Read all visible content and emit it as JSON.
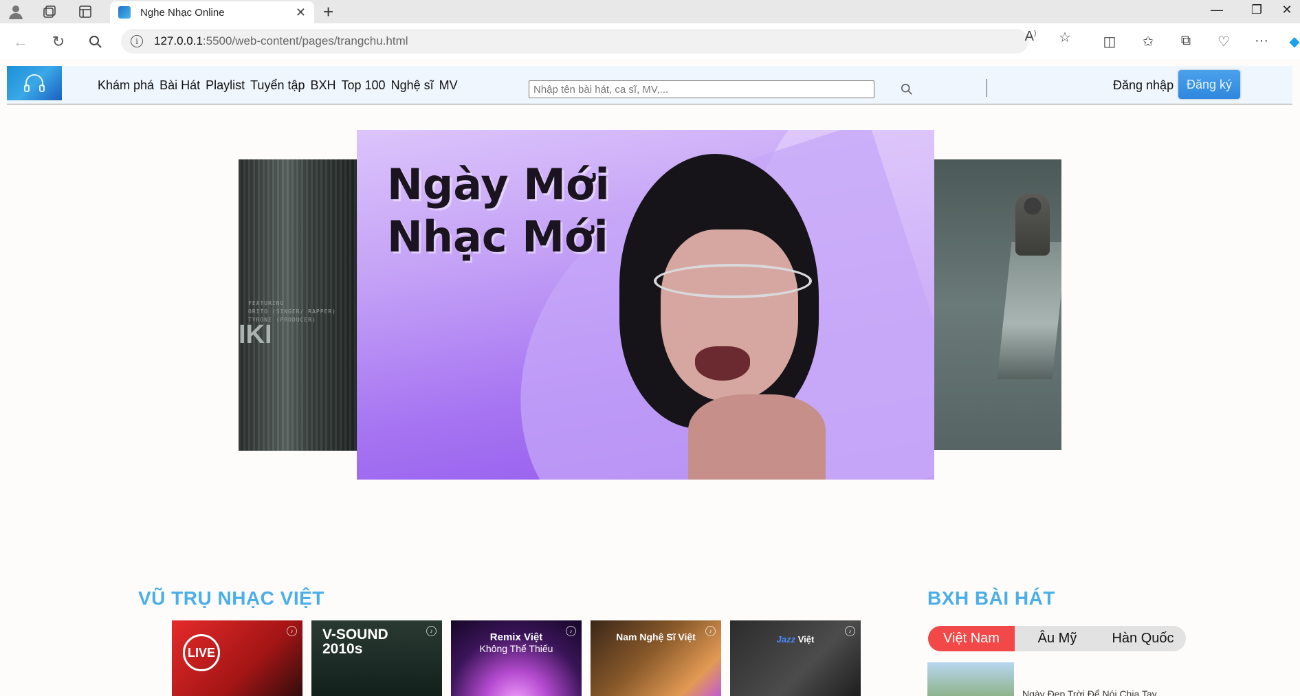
{
  "browser": {
    "tab_title": "Nghe Nhạc Online",
    "url_host": "127.0.0.1",
    "url_path": ":5500/web-content/pages/trangchu.html"
  },
  "header": {
    "logo_icon": "headphones-icon",
    "menu": [
      "Khám phá",
      "Bài Hát",
      "Playlist",
      "Tuyển tập",
      "BXH",
      "Top 100",
      "Nghệ sĩ",
      "MV"
    ],
    "search_placeholder": "Nhập tên bài hát, ca sĩ, MV,...",
    "login_label": "Đăng nhập",
    "register_label": "Đăng ký"
  },
  "carousel": {
    "main_headline_line1": "Ngày Mới",
    "main_headline_line2": "Nhạc Mới",
    "left_feature_text": "FEATURING\nORITO (SINGER/ RAPPER)\nTYRONE (PRODUCER)",
    "left_big_text": "IKI"
  },
  "sections": {
    "vu_tru_title": "VŨ TRỤ NHẠC VIỆT",
    "bxh_title": "BXH BÀI HÁT"
  },
  "cards": [
    {
      "label": "LIVE"
    },
    {
      "label_line1": "V-SOUND",
      "label_line2": "2010s"
    },
    {
      "label_line1": "Remix Việt",
      "label_line2": "Không Thể Thiếu"
    },
    {
      "label": "Nam Nghệ Sĩ Việt"
    },
    {
      "label_accent": "Jazz",
      "label": "Việt"
    }
  ],
  "bxh": {
    "tabs": [
      "Việt Nam",
      "Âu Mỹ",
      "Hàn Quốc"
    ],
    "active_tab": "Việt Nam",
    "first_song": "Ngày Đẹp Trời Để Nói Chia Tay"
  },
  "colors": {
    "accent_blue": "#49aee9",
    "active_tab_red": "#f24848",
    "register_blue": "#3a93e4"
  }
}
